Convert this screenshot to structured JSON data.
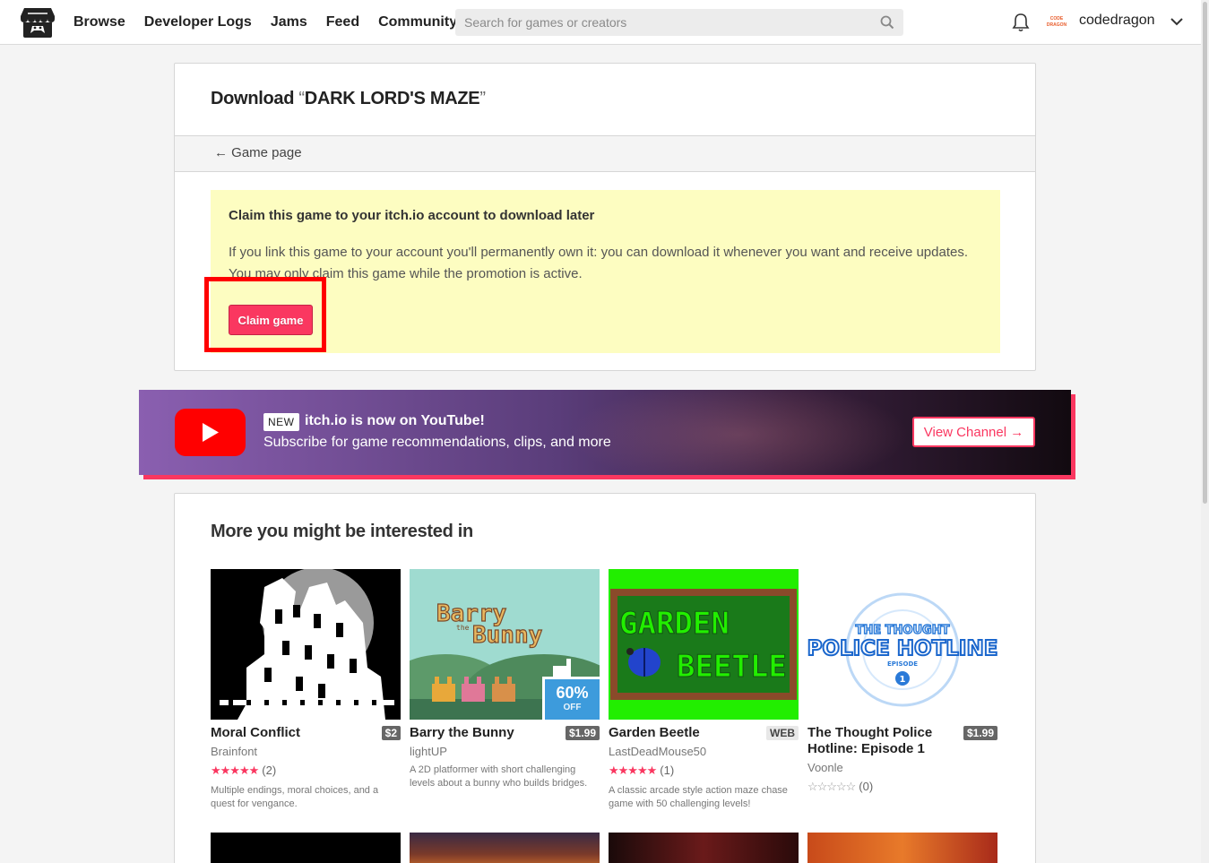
{
  "header": {
    "nav": [
      "Browse",
      "Developer Logs",
      "Jams",
      "Feed",
      "Community"
    ],
    "search_placeholder": "Search for games or creators",
    "username": "codedragon",
    "avatar_text": "CODE DRAGON",
    "icons": [
      "itchio-logo-icon",
      "search-icon",
      "bell-icon",
      "chevron-down-icon"
    ]
  },
  "download": {
    "title_prefix": "Download",
    "open_quote": "“",
    "game_name": "DARK LORD'S MAZE",
    "close_quote": "”",
    "back_link": "← Game page",
    "claim_heading": "Claim this game to your itch.io account to download later",
    "claim_body": "If you link this game to your account you'll permanently own it: you can download it whenever you want and receive updates. You may only claim this game while the promotion is active.",
    "claim_button": "Claim game"
  },
  "youtube_banner": {
    "badge": "NEW",
    "title": "itch.io is now on YouTube!",
    "subtitle": "Subscribe for game recommendations, clips, and more",
    "button": "View Channel →"
  },
  "recommendations": {
    "title": "More you might be interested in",
    "games": [
      {
        "title": "Moral Conflict",
        "price": "$2",
        "author": "Brainfont",
        "stars": "★★★★★",
        "rating_count": "(2)",
        "description": "Multiple endings, moral choices, and a quest for vengance."
      },
      {
        "title": "Barry the Bunny",
        "price": "$1.99",
        "author": "lightUP",
        "sale_percent": "60%",
        "sale_label": "OFF",
        "thumb_text": [
          "Barry",
          "the",
          "Bunny"
        ],
        "description": "A 2D platformer with short challenging levels about a bunny who builds bridges."
      },
      {
        "title": "Garden Beetle",
        "price": "WEB",
        "author": "LastDeadMouse50",
        "stars": "★★★★★",
        "rating_count": "(1)",
        "thumb_text": [
          "GARDEN",
          "BEETLE"
        ],
        "description": "A classic arcade style action maze chase game with 50 challenging levels!"
      },
      {
        "title": "The Thought Police Hotline: Episode 1",
        "price": "$1.99",
        "author": "Voonle",
        "stars": "☆☆☆☆☆",
        "rating_count": "(0)",
        "thumb_text": [
          "THE THOUGHT",
          "POLICE HOTLINE",
          "EPISODE",
          "1"
        ]
      }
    ]
  },
  "colors": {
    "accent": "#fa3760",
    "highlight": "#ff0000",
    "claim_bg": "#fdfdc1",
    "sale": "#3d9bdc"
  }
}
